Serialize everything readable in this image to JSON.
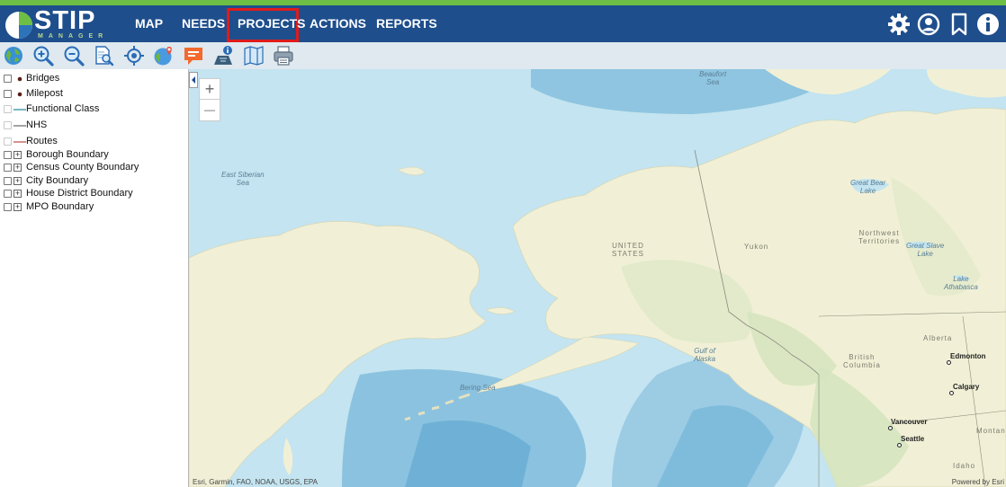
{
  "app": {
    "logo_title": "STIP",
    "logo_subtitle": "MANAGER"
  },
  "nav": {
    "items": [
      {
        "label": "MAP",
        "selected": false
      },
      {
        "label": "NEEDS",
        "selected": false
      },
      {
        "label": "PROJECTS",
        "selected": true
      },
      {
        "label": "ACTIONS",
        "selected": false
      },
      {
        "label": "REPORTS",
        "selected": false
      }
    ],
    "right_icons": [
      "settings-icon",
      "user-account-icon",
      "bookmark-icon",
      "info-icon"
    ]
  },
  "toolbar": {
    "tools": [
      "globe-icon",
      "zoom-in-icon",
      "zoom-out-icon",
      "search-document-icon",
      "locate-icon",
      "map-marker-icon",
      "comment-icon",
      "map-info-icon",
      "basemap-icon",
      "print-icon"
    ]
  },
  "layers": [
    {
      "label": "Bridges",
      "symbol": "dot",
      "checked": false,
      "enabled": true,
      "expandable": false
    },
    {
      "label": "Milepost",
      "symbol": "dot",
      "checked": false,
      "enabled": true,
      "expandable": false
    },
    {
      "label": "Functional Class",
      "symbol": "line-teal",
      "checked": false,
      "enabled": false,
      "expandable": false
    },
    {
      "label": "NHS",
      "symbol": "line-gray",
      "checked": false,
      "enabled": false,
      "expandable": false
    },
    {
      "label": "Routes",
      "symbol": "line-red",
      "checked": false,
      "enabled": false,
      "expandable": false
    },
    {
      "label": "Borough Boundary",
      "symbol": "plus",
      "checked": false,
      "enabled": true,
      "expandable": true
    },
    {
      "label": "Census County Boundary",
      "symbol": "plus",
      "checked": false,
      "enabled": true,
      "expandable": true
    },
    {
      "label": "City Boundary",
      "symbol": "plus",
      "checked": false,
      "enabled": true,
      "expandable": true
    },
    {
      "label": "House District Boundary",
      "symbol": "plus",
      "checked": false,
      "enabled": true,
      "expandable": true
    },
    {
      "label": "MPO Boundary",
      "symbol": "plus",
      "checked": false,
      "enabled": true,
      "expandable": true
    }
  ],
  "map": {
    "zoom_in": "+",
    "zoom_out": "—",
    "water_labels": [
      "Beaufort\nSea",
      "East Siberian\nSea",
      "Bering Sea",
      "Gulf of\nAlaska",
      "Great Bear\nLake",
      "Great Slave\nLake",
      "Lake\nAthabasca"
    ],
    "land_labels": [
      "UNITED\nSTATES",
      "Yukon",
      "Northwest\nTerritories",
      "Alberta",
      "British\nColumbia",
      "Montan",
      "Idaho"
    ],
    "cities": [
      "Edmonton",
      "Calgary",
      "Vancouver",
      "Seattle"
    ],
    "attribution": "Esri, Garmin, FAO, NOAA, USGS, EPA",
    "powered_by": "Powered by Esri"
  },
  "colors": {
    "header": "#1e4e8c",
    "accent_green": "#6dbe45",
    "selected_border": "#e01b1b",
    "water": "#bfe2ef",
    "land": "#f1f0d6"
  }
}
